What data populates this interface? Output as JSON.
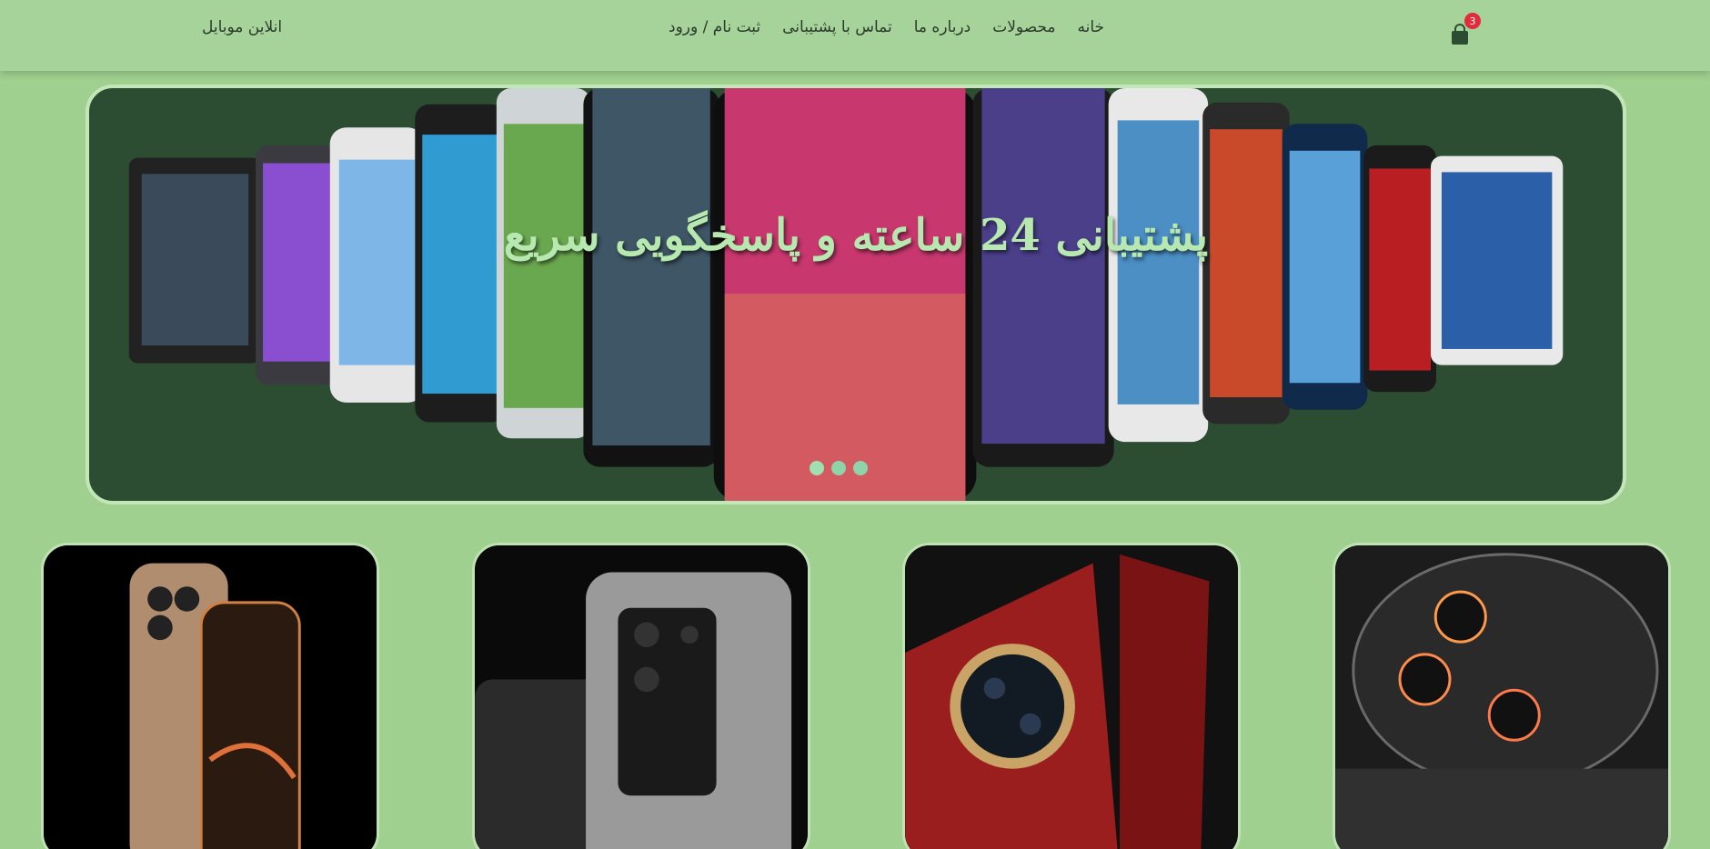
{
  "brand": "انلاین موبایل",
  "nav": {
    "items": [
      "خانه",
      "محصولات",
      "درباره ما",
      "تماس با پشتیبانی",
      "ثبت نام / ورود"
    ]
  },
  "cart": {
    "count": "3",
    "icon": "shopping-bag-icon"
  },
  "hero": {
    "title": "پشتیبانی 24 ساعته و پاسخگویی سریع",
    "slides": 3,
    "active_slide": 0
  },
  "products": [
    {
      "icon": "iphone-image"
    },
    {
      "icon": "samsung-ultra-image"
    },
    {
      "icon": "foldable-phone-image"
    },
    {
      "icon": "camera-phone-image"
    }
  ],
  "colors": {
    "page_bg": "#9fd08f",
    "navbar_bg": "#a6d39a",
    "hero_bg": "#2d4d33",
    "hero_title": "#b7e8b0",
    "badge": "#e02c3c"
  }
}
